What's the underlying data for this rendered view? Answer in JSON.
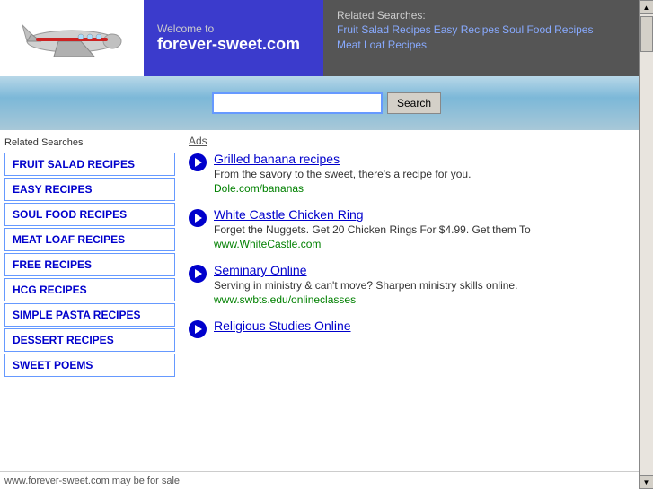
{
  "header": {
    "welcome_text": "Welcome to",
    "domain": "forever-sweet.com",
    "related_label": "Related Searches:",
    "related_links": [
      {
        "label": "Fruit Salad Recipes",
        "url": "#"
      },
      {
        "label": "Easy Recipes",
        "url": "#"
      },
      {
        "label": "Soul Food Recipes",
        "url": "#"
      },
      {
        "label": "Meat Loaf Recipes",
        "url": "#"
      }
    ]
  },
  "search": {
    "placeholder": "",
    "button_label": "Search"
  },
  "sidebar": {
    "title": "Related Searches",
    "items": [
      {
        "label": "FRUIT SALAD RECIPES"
      },
      {
        "label": "EASY RECIPES"
      },
      {
        "label": "SOUL FOOD RECIPES"
      },
      {
        "label": "MEAT LOAF RECIPES"
      },
      {
        "label": "FREE RECIPES"
      },
      {
        "label": "HCG RECIPES"
      },
      {
        "label": "SIMPLE PASTA RECIPES"
      },
      {
        "label": "DESSERT RECIPES"
      },
      {
        "label": "SWEET POEMS"
      }
    ]
  },
  "ads": {
    "label": "Ads",
    "items": [
      {
        "title": "Grilled banana recipes",
        "desc": "From the savory to the sweet, there's a recipe for you.",
        "url": "Dole.com/bananas"
      },
      {
        "title": "White Castle Chicken Ring",
        "desc": "Forget the Nuggets. Get 20 Chicken Rings For $4.99. Get them To",
        "url": "www.WhiteCastle.com"
      },
      {
        "title": "Seminary Online",
        "desc": "Serving in ministry & can't move? Sharpen ministry skills online.",
        "url": "www.swbts.edu/onlineclasses"
      },
      {
        "title": "Religious Studies Online",
        "desc": "",
        "url": ""
      }
    ]
  },
  "footer": {
    "text": "www.forever-sweet.com may be for sale"
  }
}
